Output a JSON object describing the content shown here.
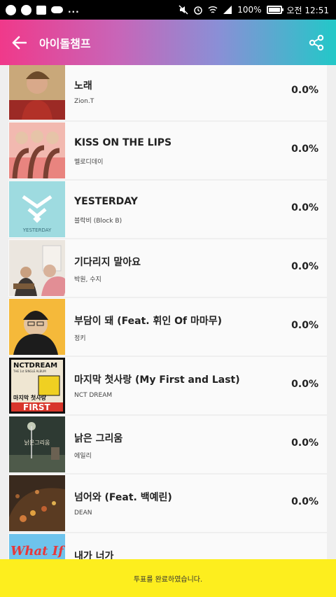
{
  "status_bar": {
    "battery": "100%",
    "time": "오전 12:51",
    "more": "..."
  },
  "app_bar": {
    "title": "아이돌챔프"
  },
  "songs": [
    {
      "title": "노래",
      "artist": "Zion.T",
      "percent": "0.0%"
    },
    {
      "title": "KISS ON THE LIPS",
      "artist": "멜로디데이",
      "percent": "0.0%"
    },
    {
      "title": "YESTERDAY",
      "artist": "블락비 (Block B)",
      "percent": "0.0%"
    },
    {
      "title": "기다리지 말아요",
      "artist": "박원, 수지",
      "percent": "0.0%"
    },
    {
      "title": "부담이 돼 (Feat. 휘인 Of 마마무)",
      "artist": "정키",
      "percent": "0.0%"
    },
    {
      "title": "마지막 첫사랑 (My First and Last)",
      "artist": "NCT DREAM",
      "percent": "0.0%"
    },
    {
      "title": "낡은 그리움",
      "artist": "에일리",
      "percent": "0.0%"
    },
    {
      "title": "넘어와 (Feat. 백예린)",
      "artist": "DEAN",
      "percent": "0.0%"
    },
    {
      "title": "내가 너가",
      "artist": "",
      "percent": ""
    }
  ],
  "album_art": {
    "yesterday_text": "YESTERDAY",
    "nct_top": "NCTDREAM",
    "nct_sub": "THE 1st SINGLE ALBUM",
    "nct_title": "마지막 첫사랑",
    "nct_first": "FIRST",
    "ailee_text": "낡은그리움",
    "whatif_text": "What If"
  },
  "bottom_bar": {
    "message": "투표를 완료하였습니다."
  },
  "colors": {
    "appbar_start": "#f0398a",
    "appbar_end": "#22c8c8",
    "bottom_bar": "#fdee1e"
  }
}
